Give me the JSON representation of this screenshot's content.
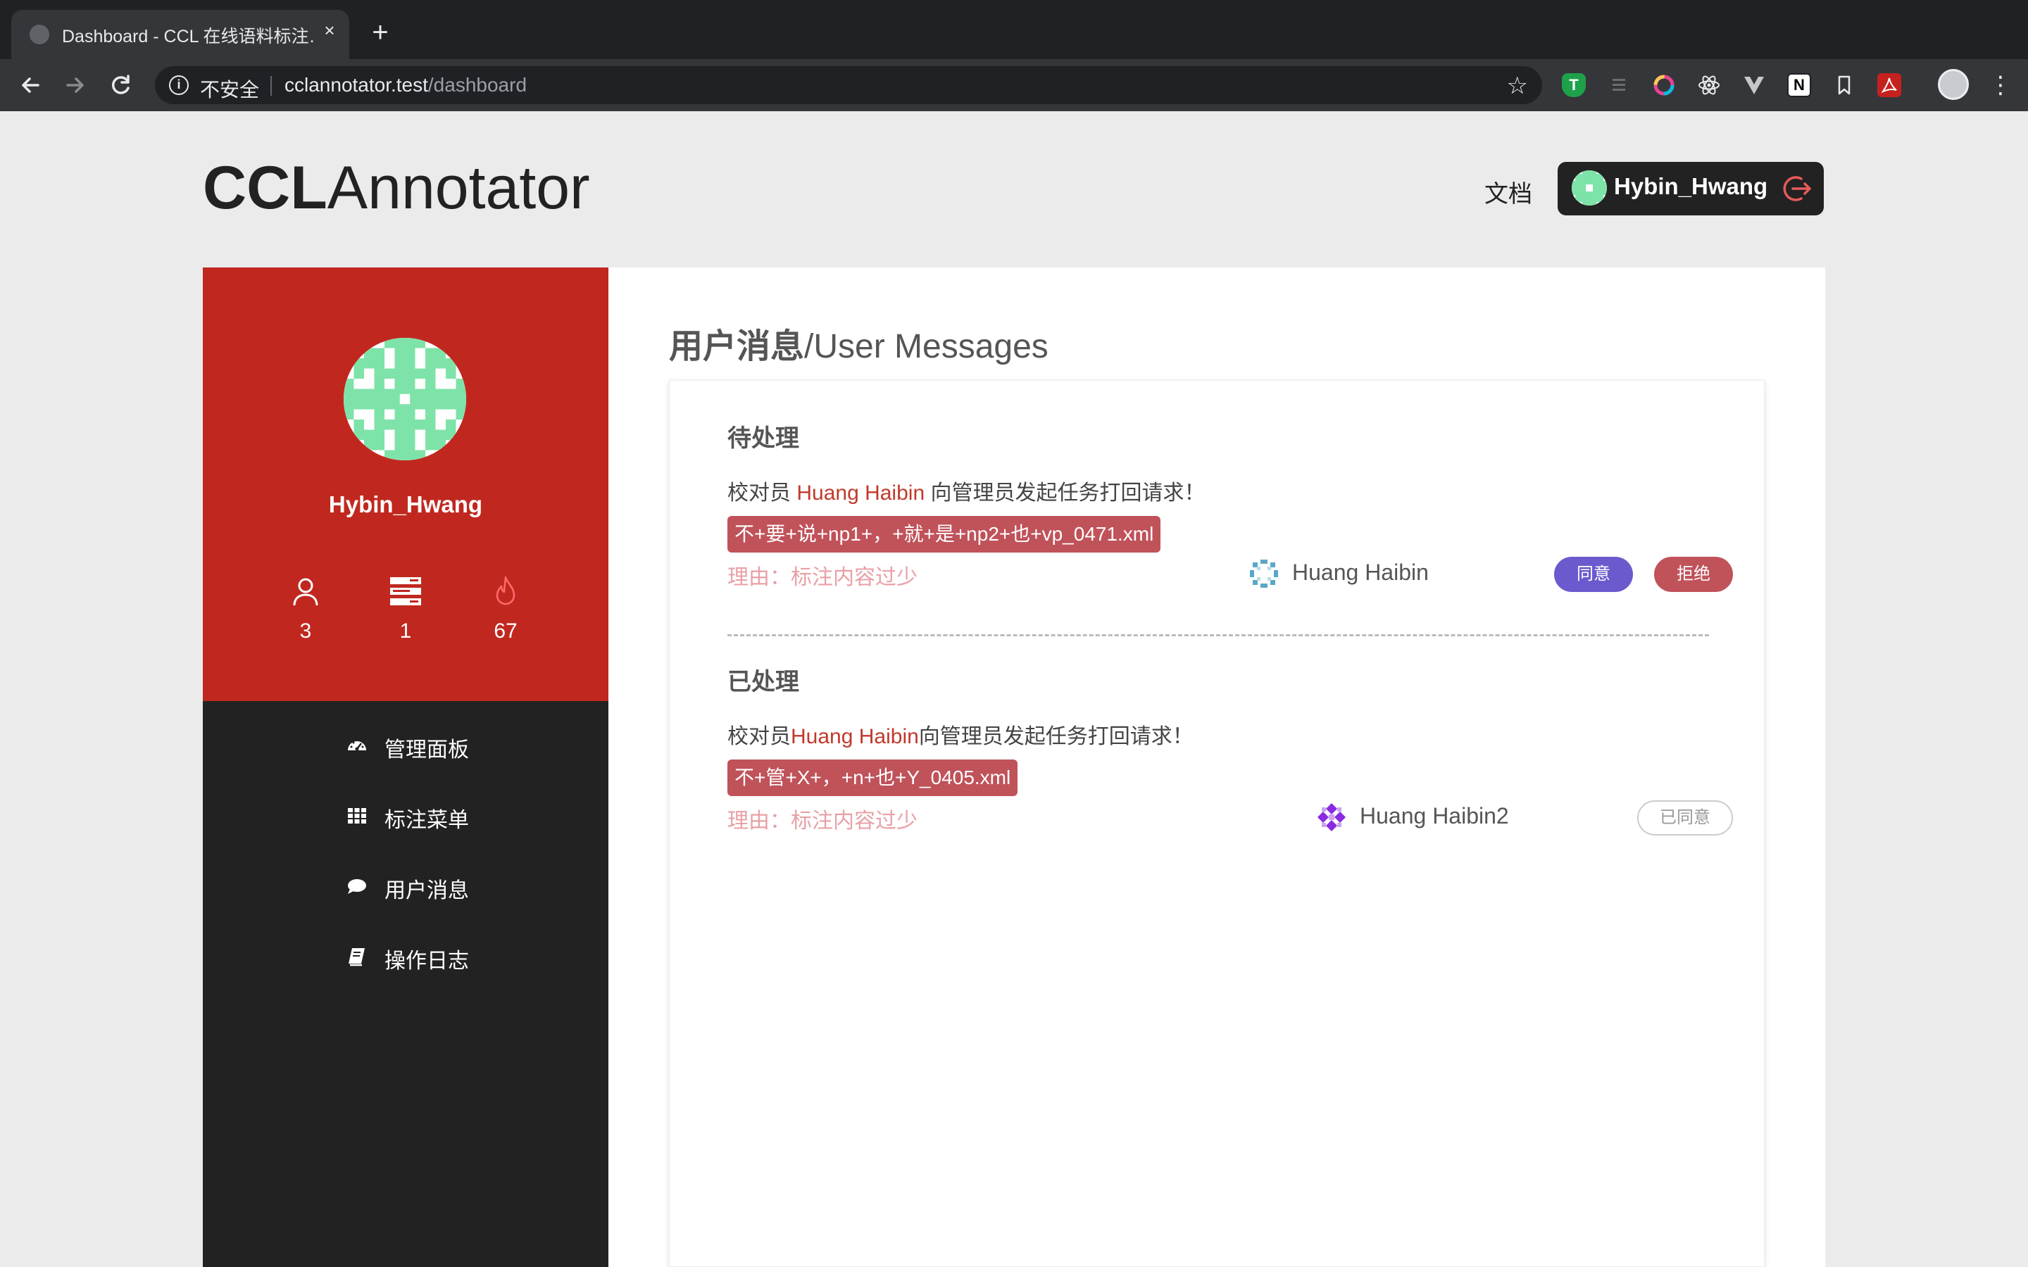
{
  "browser": {
    "tab_title": "Dashboard - CCL 在线语料标注…",
    "tab_close": "×",
    "new_tab": "+",
    "insecure_label": "不安全",
    "url_host": "cclannotator.test",
    "url_path": "/dashboard",
    "extension_icons": [
      "shield-t-icon",
      "list-icon",
      "color-ring-icon",
      "react-icon",
      "vue-icon",
      "notion-icon",
      "bookmark-icon",
      "acrobat-icon"
    ],
    "extension_notion_letter": "N"
  },
  "header": {
    "logo_bold": "CCL",
    "logo_light": "Annotator",
    "docs_label": "文档",
    "username": "Hybin_Hwang"
  },
  "sidebar": {
    "username": "Hybin_Hwang",
    "stats": [
      {
        "icon": "user-icon",
        "value": "3"
      },
      {
        "icon": "server-icon",
        "value": "1"
      },
      {
        "icon": "fire-icon",
        "value": "67"
      }
    ],
    "nav": [
      {
        "icon": "dashboard-icon",
        "label": "管理面板"
      },
      {
        "icon": "grid-icon",
        "label": "标注菜单"
      },
      {
        "icon": "comment-icon",
        "label": "用户消息"
      },
      {
        "icon": "book-icon",
        "label": "操作日志"
      }
    ]
  },
  "main": {
    "title_zh": "用户消息",
    "title_en": "/User Messages",
    "pending": {
      "section_title": "待处理",
      "msg_prefix": "校对员 ",
      "msg_user": "Huang Haibin",
      "msg_suffix": " 向管理员发起任务打回请求！",
      "file": "不+要+说+np1+，+就+是+np2+也+vp_0471.xml",
      "reason": "理由：标注内容过少",
      "sender": "Huang Haibin",
      "agree_label": "同意",
      "reject_label": "拒绝"
    },
    "processed": {
      "section_title": "已处理",
      "msg_prefix": "校对员",
      "msg_user": "Huang Haibin",
      "msg_suffix": "向管理员发起任务打回请求！",
      "file": "不+管+X+，+n+也+Y_0405.xml",
      "reason": "理由：标注内容过少",
      "sender": "Huang Haibin2",
      "status_label": "已同意"
    }
  },
  "colors": {
    "sidebar_red": "#c0281f",
    "sidebar_dark": "#222222",
    "accent_purple": "#6a5acd",
    "tag_red": "#c0525a",
    "avatar_green": "#7ee3a8"
  }
}
